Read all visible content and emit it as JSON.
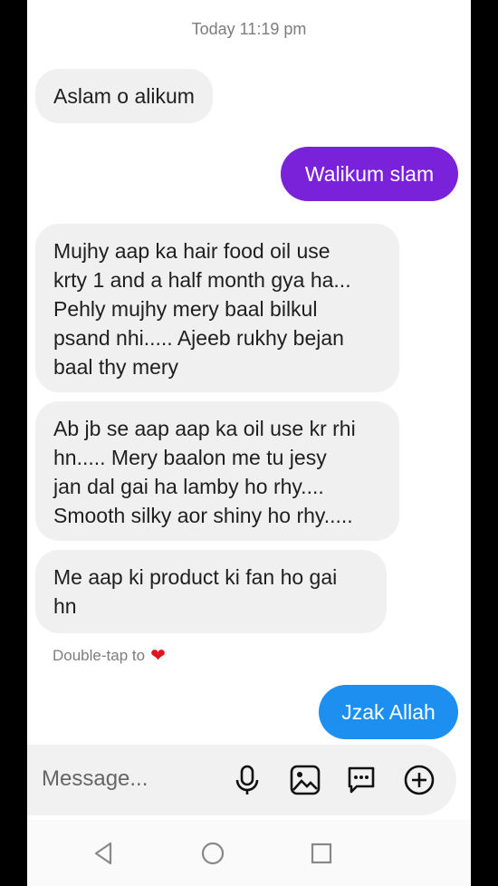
{
  "chat": {
    "timestamp": "Today 11:19 pm",
    "messages": [
      {
        "direction": "incoming",
        "text": "Aslam o alikum"
      },
      {
        "direction": "outgoing",
        "text": "Walikum slam",
        "color": "#7a22d9"
      },
      {
        "direction": "incoming",
        "text": "Mujhy aap ka hair food oil use\nkrty 1 and a half month gya ha...\nPehly mujhy mery baal bilkul\npsand nhi..... Ajeeb rukhy bejan\nbaal thy mery"
      },
      {
        "direction": "incoming",
        "text": "Ab jb se aap aap ka oil use kr rhi\nhn..... Mery baalon me tu jesy\njan dal gai ha lamby ho rhy....\nSmooth silky aor shiny ho rhy....."
      },
      {
        "direction": "incoming",
        "text": "Me aap ki product ki fan ho gai\nhn"
      },
      {
        "direction": "outgoing",
        "text": "Jzak Allah",
        "color": "#1d8ff0"
      }
    ],
    "reaction_hint": "Double-tap to",
    "reaction_icon": "heart-icon"
  },
  "composer": {
    "placeholder": "Message...",
    "icons": [
      "microphone-icon",
      "image-icon",
      "sticker-icon",
      "add-icon"
    ]
  },
  "navbar": {
    "icons": [
      "back-icon",
      "home-icon",
      "recents-icon"
    ]
  }
}
